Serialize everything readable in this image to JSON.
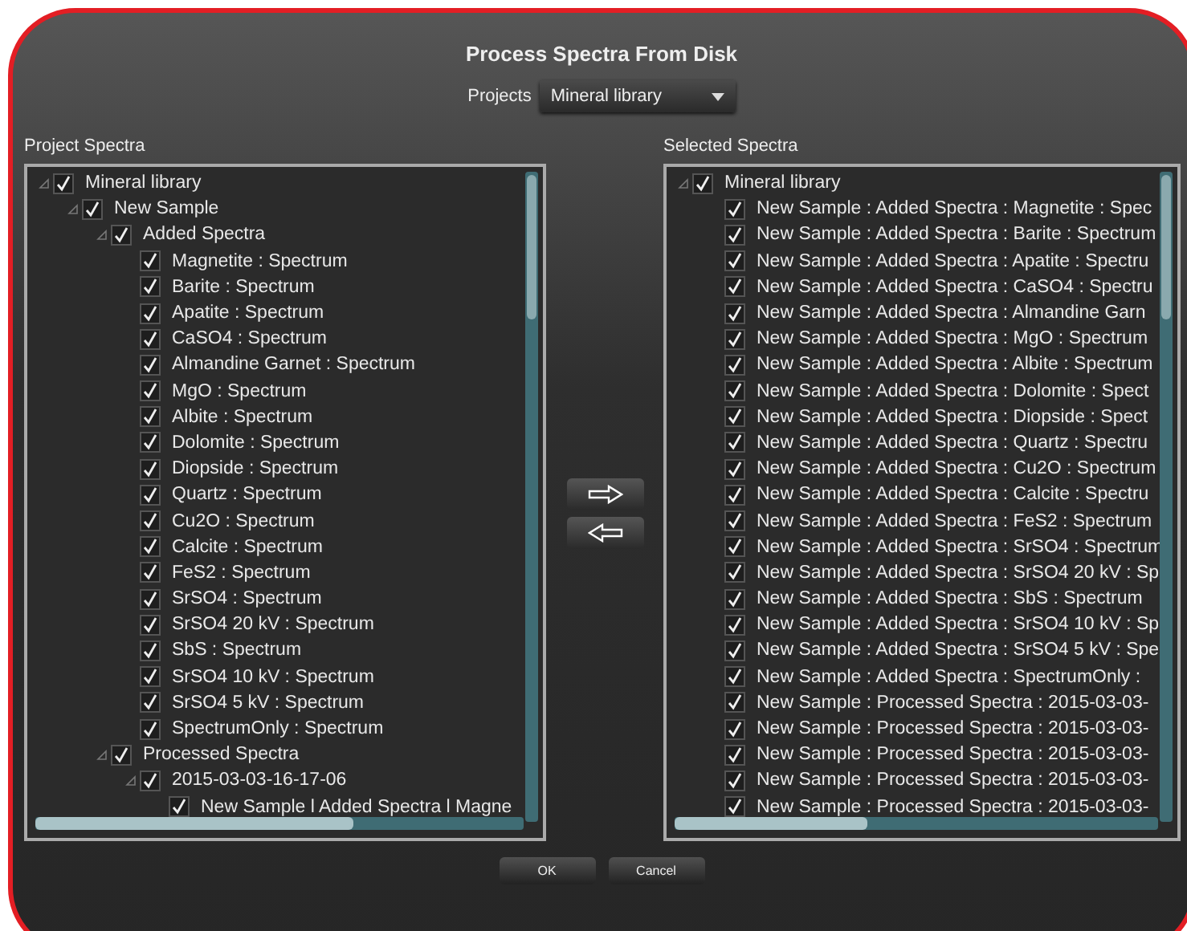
{
  "dialog": {
    "title": "Process Spectra From Disk"
  },
  "projects": {
    "label": "Projects",
    "value": "Mineral library"
  },
  "project_spectra": {
    "label": "Project Spectra",
    "tree": [
      {
        "label": "Mineral library",
        "checked": true,
        "expanded": true,
        "children": [
          {
            "label": "New Sample",
            "checked": true,
            "expanded": true,
            "children": [
              {
                "label": "Added Spectra",
                "checked": true,
                "expanded": true,
                "children": [
                  {
                    "label": "Magnetite : Spectrum",
                    "checked": true
                  },
                  {
                    "label": "Barite : Spectrum",
                    "checked": true
                  },
                  {
                    "label": "Apatite : Spectrum",
                    "checked": true
                  },
                  {
                    "label": "CaSO4 : Spectrum",
                    "checked": true
                  },
                  {
                    "label": "Almandine Garnet : Spectrum",
                    "checked": true
                  },
                  {
                    "label": "MgO : Spectrum",
                    "checked": true
                  },
                  {
                    "label": "Albite : Spectrum",
                    "checked": true
                  },
                  {
                    "label": "Dolomite : Spectrum",
                    "checked": true
                  },
                  {
                    "label": "Diopside : Spectrum",
                    "checked": true
                  },
                  {
                    "label": "Quartz : Spectrum",
                    "checked": true
                  },
                  {
                    "label": "Cu2O : Spectrum",
                    "checked": true
                  },
                  {
                    "label": "Calcite : Spectrum",
                    "checked": true
                  },
                  {
                    "label": "FeS2 : Spectrum",
                    "checked": true
                  },
                  {
                    "label": "SrSO4 : Spectrum",
                    "checked": true
                  },
                  {
                    "label": "SrSO4 20 kV : Spectrum",
                    "checked": true
                  },
                  {
                    "label": "SbS : Spectrum",
                    "checked": true
                  },
                  {
                    "label": "SrSO4 10 kV : Spectrum",
                    "checked": true
                  },
                  {
                    "label": "SrSO4 5 kV : Spectrum",
                    "checked": true
                  },
                  {
                    "label": "SpectrumOnly : Spectrum",
                    "checked": true
                  }
                ]
              },
              {
                "label": "Processed Spectra",
                "checked": true,
                "expanded": true,
                "children": [
                  {
                    "label": "2015-03-03-16-17-06",
                    "checked": true,
                    "expanded": true,
                    "children": [
                      {
                        "label": "New Sample l Added Spectra l Magne",
                        "checked": true
                      }
                    ]
                  }
                ]
              }
            ]
          }
        ]
      }
    ]
  },
  "selected_spectra": {
    "label": "Selected Spectra",
    "tree": [
      {
        "label": "Mineral library",
        "checked": true,
        "expanded": true,
        "children": [
          {
            "label": "New Sample : Added Spectra : Magnetite : Spec",
            "checked": true
          },
          {
            "label": "New Sample : Added Spectra : Barite : Spectrum",
            "checked": true
          },
          {
            "label": "New Sample : Added Spectra : Apatite : Spectru",
            "checked": true
          },
          {
            "label": "New Sample : Added Spectra : CaSO4 : Spectru",
            "checked": true
          },
          {
            "label": "New Sample : Added Spectra : Almandine Garn",
            "checked": true
          },
          {
            "label": "New Sample : Added Spectra : MgO : Spectrum",
            "checked": true
          },
          {
            "label": "New Sample : Added Spectra : Albite : Spectrum",
            "checked": true
          },
          {
            "label": "New Sample : Added Spectra : Dolomite : Spect",
            "checked": true
          },
          {
            "label": "New Sample : Added Spectra : Diopside : Spect",
            "checked": true
          },
          {
            "label": "New Sample : Added Spectra : Quartz : Spectru",
            "checked": true
          },
          {
            "label": "New Sample : Added Spectra : Cu2O : Spectrum",
            "checked": true
          },
          {
            "label": "New Sample : Added Spectra : Calcite : Spectru",
            "checked": true
          },
          {
            "label": "New Sample : Added Spectra : FeS2 : Spectrum",
            "checked": true
          },
          {
            "label": "New Sample : Added Spectra : SrSO4 : Spectrum",
            "checked": true
          },
          {
            "label": "New Sample : Added Spectra : SrSO4 20 kV : Sp",
            "checked": true
          },
          {
            "label": "New Sample : Added Spectra : SbS : Spectrum",
            "checked": true
          },
          {
            "label": "New Sample : Added Spectra : SrSO4 10 kV : Sp",
            "checked": true
          },
          {
            "label": "New Sample : Added Spectra : SrSO4 5 kV : Spe",
            "checked": true
          },
          {
            "label": "New Sample : Added Spectra : SpectrumOnly :",
            "checked": true
          },
          {
            "label": "New Sample : Processed Spectra : 2015-03-03-",
            "checked": true
          },
          {
            "label": "New Sample : Processed Spectra : 2015-03-03-",
            "checked": true
          },
          {
            "label": "New Sample : Processed Spectra : 2015-03-03-",
            "checked": true
          },
          {
            "label": "New Sample : Processed Spectra : 2015-03-03-",
            "checked": true
          },
          {
            "label": "New Sample : Processed Spectra : 2015-03-03-",
            "checked": true
          }
        ]
      }
    ]
  },
  "buttons": [
    "OK",
    "Cancel"
  ]
}
